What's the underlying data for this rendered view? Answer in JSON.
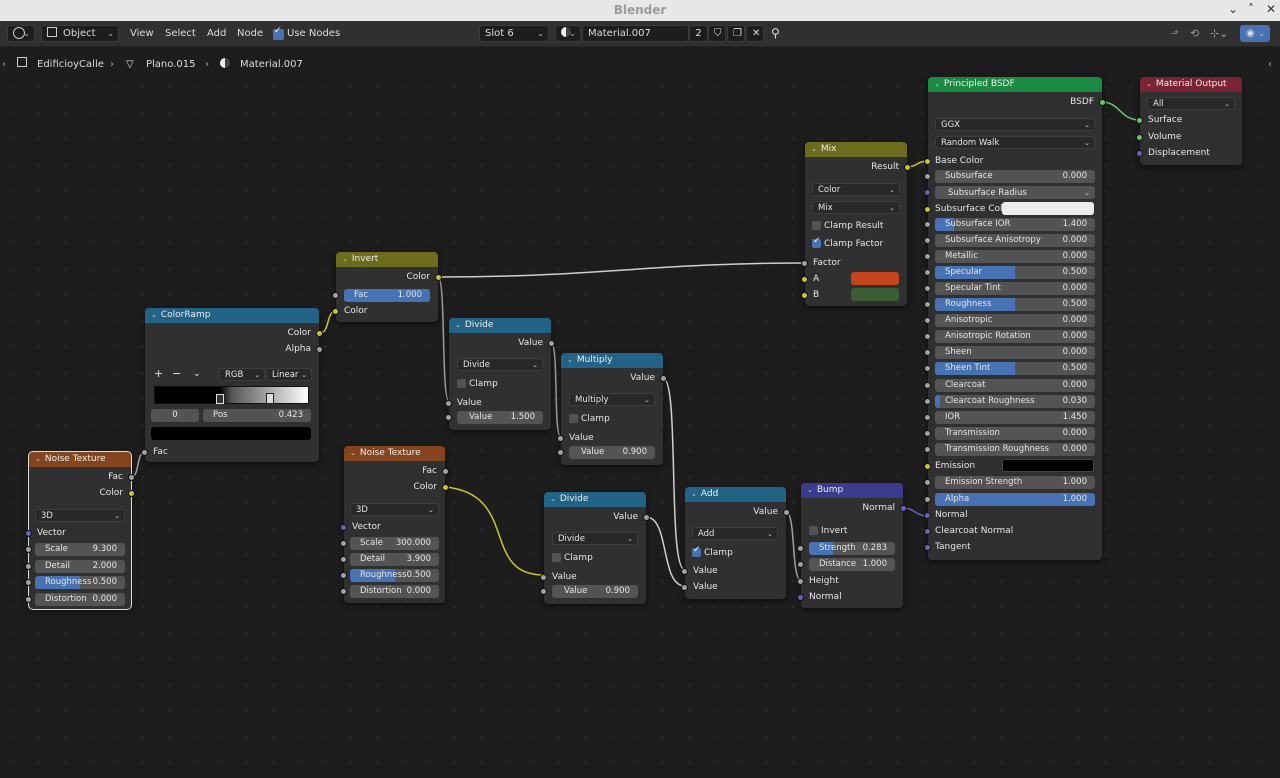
{
  "window": {
    "title": "Blender"
  },
  "header": {
    "editor_icon": "node-editor-icon",
    "object_mode": "Object",
    "menu": [
      "View",
      "Select",
      "Add",
      "Node"
    ],
    "use_nodes_label": "Use Nodes",
    "use_nodes_checked": true,
    "slot": "Slot 6",
    "material_name": "Material.007",
    "user_count": "2"
  },
  "breadcrumb": [
    "EdificioyCalle",
    "Plano.015",
    "Material.007"
  ],
  "nodes": {
    "noise1": {
      "title": "Noise Texture",
      "outputs": [
        "Fac",
        "Color"
      ],
      "dims": "3D",
      "vector": "Vector",
      "fields": [
        {
          "label": "Scale",
          "value": "9.300",
          "fill": 0
        },
        {
          "label": "Detail",
          "value": "2.000",
          "fill": 0
        },
        {
          "label": "Roughness",
          "value": "0.500",
          "fill": 0.5
        },
        {
          "label": "Distortion",
          "value": "0.000",
          "fill": 0
        }
      ]
    },
    "colorramp": {
      "title": "ColorRamp",
      "outputs": [
        "Color",
        "Alpha"
      ],
      "plus": "+",
      "minus": "−",
      "mode": "RGB",
      "interp": "Linear",
      "stop_index": "0",
      "pos_label": "Pos",
      "pos_value": "0.423",
      "input": "Fac"
    },
    "invert": {
      "title": "Invert",
      "output": "Color",
      "fac_label": "Fac",
      "fac_value": "1.000",
      "fac_fill": 1,
      "input": "Color"
    },
    "divide1": {
      "title": "Divide",
      "output": "Value",
      "op": "Divide",
      "clamp_label": "Clamp",
      "input1": "Value",
      "field_label": "Value",
      "field_value": "1.500"
    },
    "multiply": {
      "title": "Multiply",
      "output": "Value",
      "op": "Multiply",
      "clamp_label": "Clamp",
      "input1": "Value",
      "field_label": "Value",
      "field_value": "0.900"
    },
    "noise2": {
      "title": "Noise Texture",
      "outputs": [
        "Fac",
        "Color"
      ],
      "dims": "3D",
      "vector": "Vector",
      "fields": [
        {
          "label": "Scale",
          "value": "300.000",
          "fill": 0
        },
        {
          "label": "Detail",
          "value": "3.900",
          "fill": 0
        },
        {
          "label": "Roughness",
          "value": "0.500",
          "fill": 0.5
        },
        {
          "label": "Distortion",
          "value": "0.000",
          "fill": 0
        }
      ]
    },
    "divide2": {
      "title": "Divide",
      "output": "Value",
      "op": "Divide",
      "clamp_label": "Clamp",
      "input1": "Value",
      "field_label": "Value",
      "field_value": "0.900"
    },
    "add": {
      "title": "Add",
      "output": "Value",
      "op": "Add",
      "clamp_label": "Clamp",
      "inputs": [
        "Value",
        "Value"
      ]
    },
    "bump": {
      "title": "Bump",
      "output": "Normal",
      "invert_label": "Invert",
      "strength_label": "Strength",
      "strength_value": "0.283",
      "strength_fill": 0.283,
      "distance_label": "Distance",
      "distance_value": "1.000",
      "inputs": [
        "Height",
        "Normal"
      ]
    },
    "mix": {
      "title": "Mix",
      "output": "Result",
      "data_type": "Color",
      "blend": "Mix",
      "clamp_result": "Clamp Result",
      "clamp_factor": "Clamp Factor",
      "inputs": [
        "Factor",
        "A",
        "B"
      ],
      "color_a": "#c4441e",
      "color_b": "#3c5e35"
    },
    "principled": {
      "title": "Principled BSDF",
      "output": "BSDF",
      "distribution": "GGX",
      "subsurface_method": "Random Walk",
      "base_color": "Base Color",
      "subsurface_radius": "Subsurface Radius",
      "subsurface_color_label": "Subsurface Color",
      "subsurface_color": "#ececec",
      "emission_label": "Emission",
      "emission_color": "#000000",
      "fields_a": [
        {
          "label": "Subsurface",
          "value": "0.000",
          "fill": 0
        }
      ],
      "fields_b": [
        {
          "label": "Subsurface IOR",
          "value": "1.400",
          "fill": 0.12
        },
        {
          "label": "Subsurface Anisotropy",
          "value": "0.000",
          "fill": 0
        },
        {
          "label": "Metallic",
          "value": "0.000",
          "fill": 0
        },
        {
          "label": "Specular",
          "value": "0.500",
          "fill": 0.5
        },
        {
          "label": "Specular Tint",
          "value": "0.000",
          "fill": 0
        },
        {
          "label": "Roughness",
          "value": "0.500",
          "fill": 0.5
        },
        {
          "label": "Anisotropic",
          "value": "0.000",
          "fill": 0
        },
        {
          "label": "Anisotropic Rotation",
          "value": "0.000",
          "fill": 0
        },
        {
          "label": "Sheen",
          "value": "0.000",
          "fill": 0
        },
        {
          "label": "Sheen Tint",
          "value": "0.500",
          "fill": 0.5
        },
        {
          "label": "Clearcoat",
          "value": "0.000",
          "fill": 0
        },
        {
          "label": "Clearcoat Roughness",
          "value": "0.030",
          "fill": 0.03
        },
        {
          "label": "IOR",
          "value": "1.450",
          "fill": 0
        },
        {
          "label": "Transmission",
          "value": "0.000",
          "fill": 0
        },
        {
          "label": "Transmission Roughness",
          "value": "0.000",
          "fill": 0
        }
      ],
      "fields_c": [
        {
          "label": "Emission Strength",
          "value": "1.000",
          "fill": 0
        },
        {
          "label": "Alpha",
          "value": "1.000",
          "fill": 1
        }
      ],
      "inputs_tail": [
        "Normal",
        "Clearcoat Normal",
        "Tangent"
      ]
    },
    "output": {
      "title": "Material Output",
      "target": "All",
      "inputs": [
        "Surface",
        "Volume",
        "Displacement"
      ]
    }
  }
}
